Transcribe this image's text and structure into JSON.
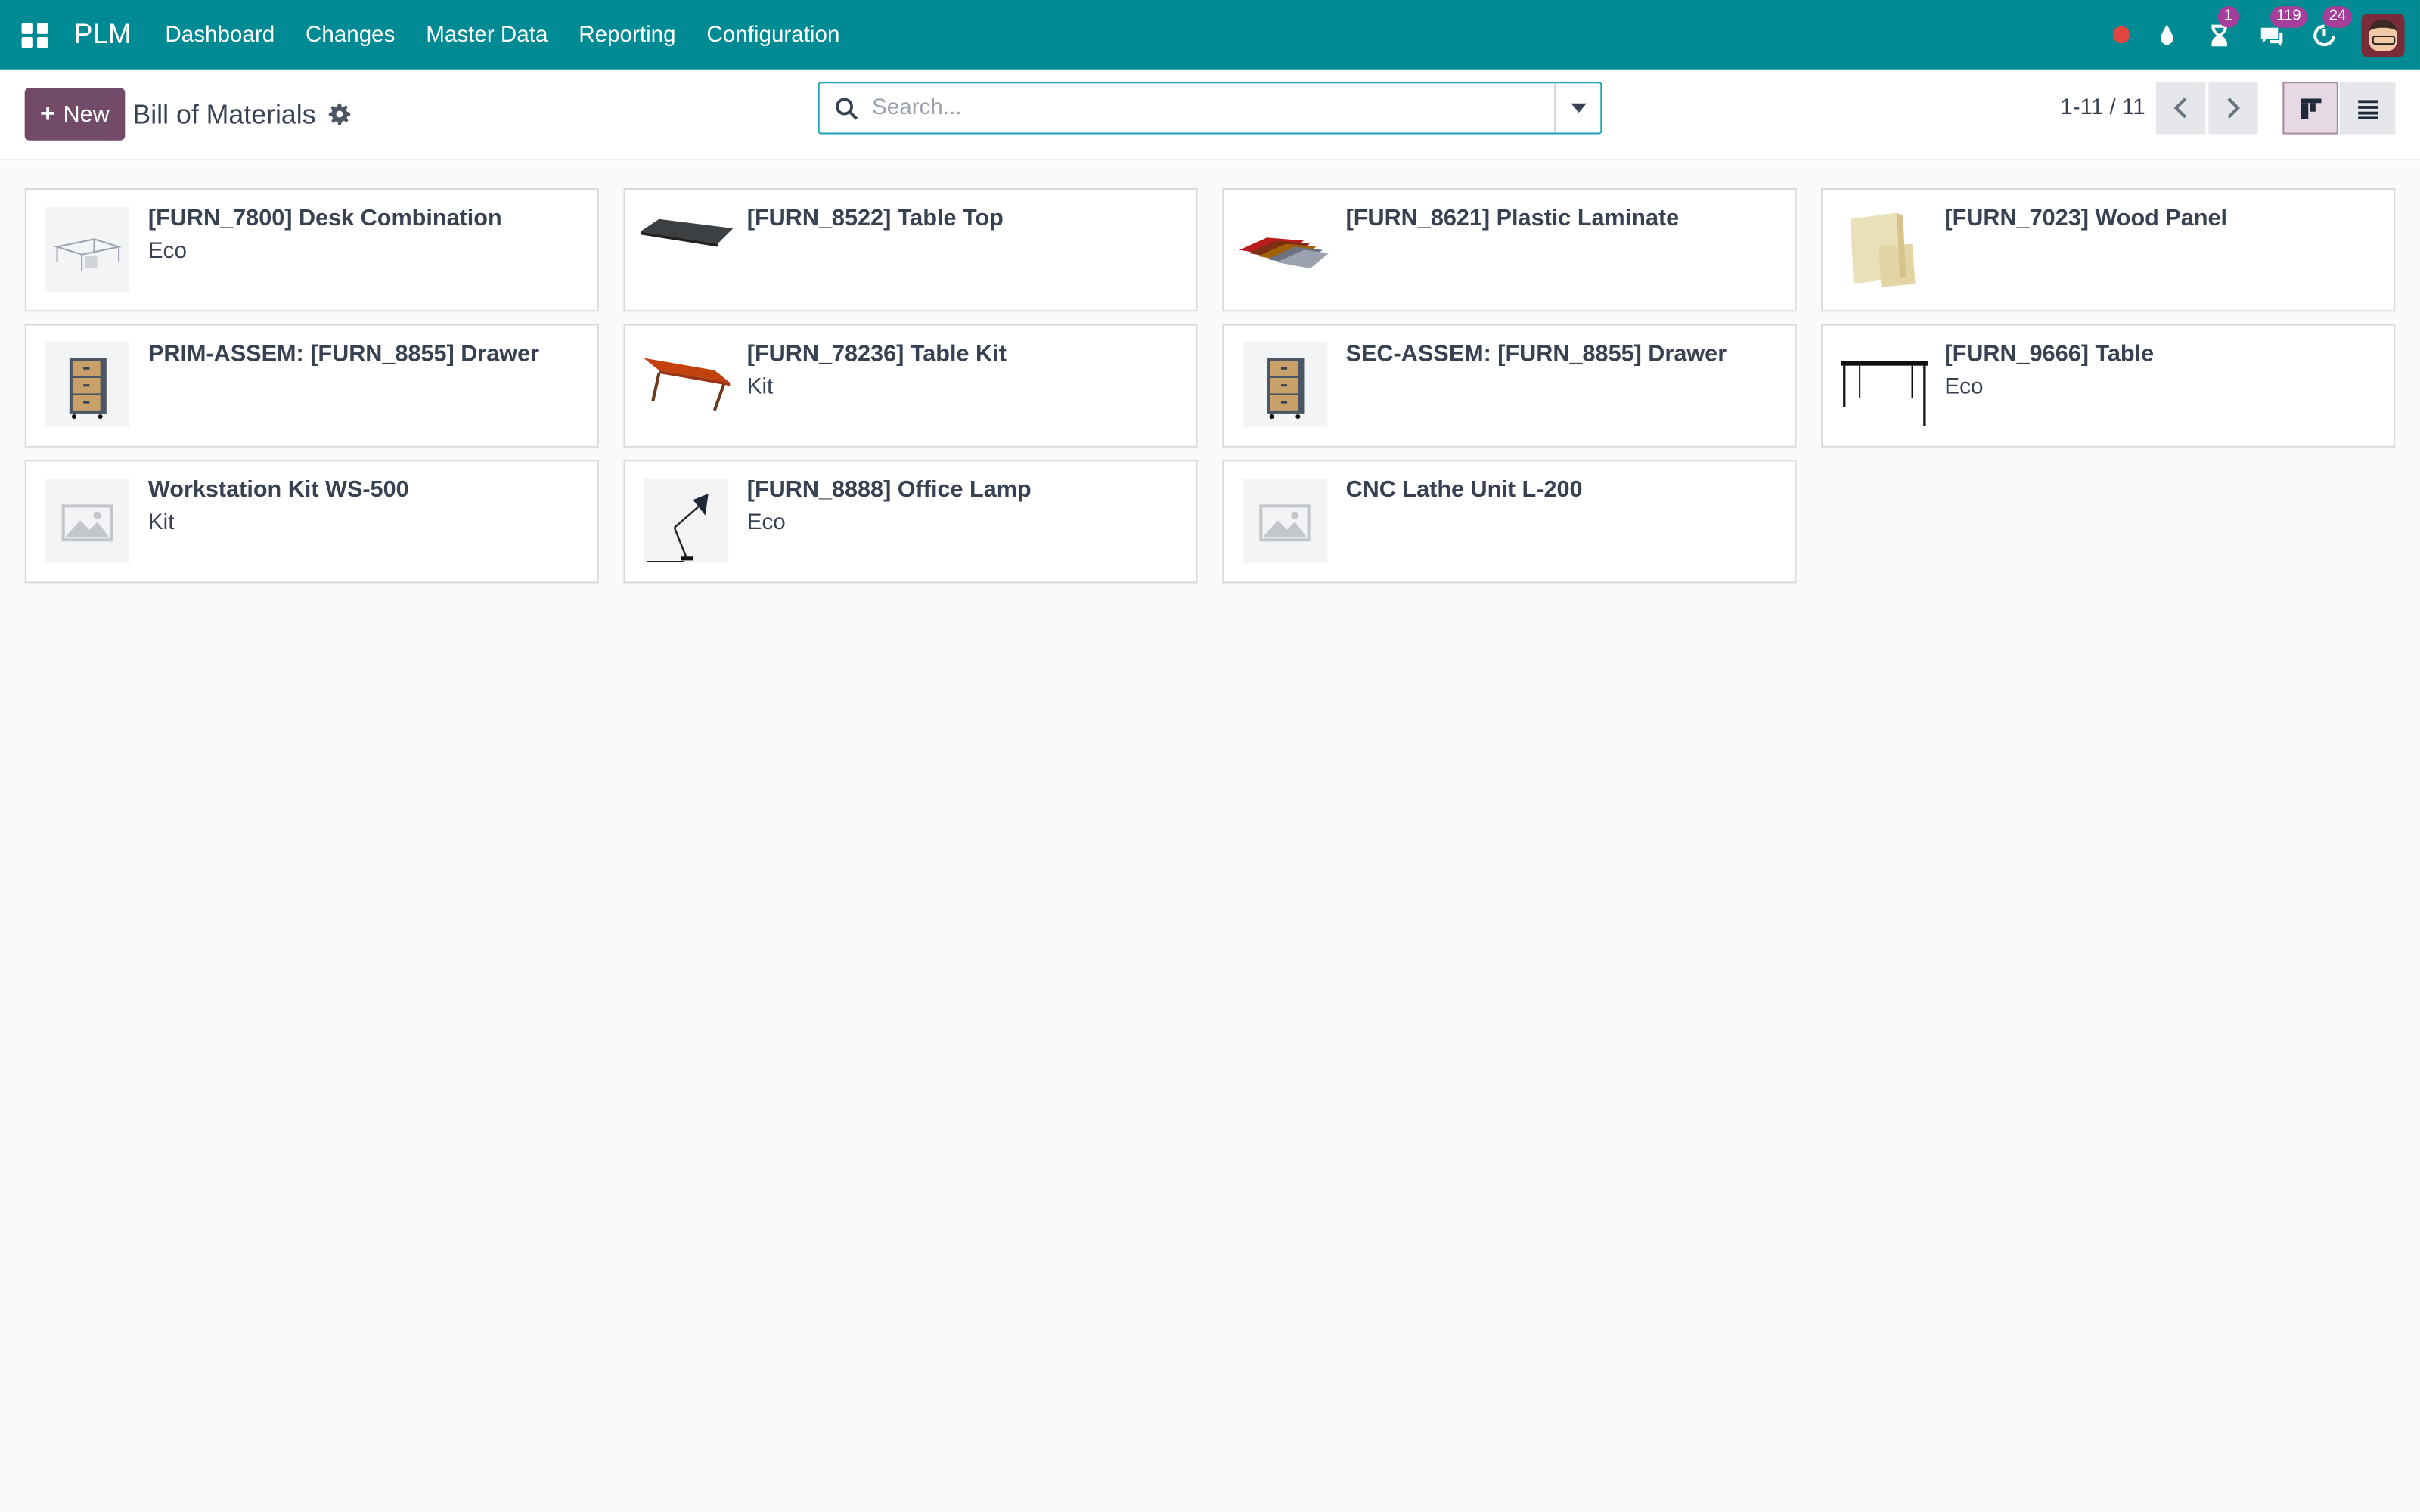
{
  "navbar": {
    "brand": "PLM",
    "menu": [
      "Dashboard",
      "Changes",
      "Master Data",
      "Reporting",
      "Configuration"
    ],
    "badges": {
      "activities": "1",
      "messages": "119",
      "updates": "24"
    }
  },
  "control": {
    "new_label": "New",
    "breadcrumb": "Bill of Materials",
    "search_placeholder": "Search...",
    "pager": "1-11 / 11"
  },
  "cards": [
    {
      "title": "[FURN_7800] Desk Combination",
      "tag": "Eco",
      "image": "desk-combination"
    },
    {
      "title": "[FURN_8522] Table Top",
      "tag": "",
      "image": "table-top"
    },
    {
      "title": "[FURN_8621] Plastic Laminate",
      "tag": "",
      "image": "laminate"
    },
    {
      "title": "[FURN_7023] Wood Panel",
      "tag": "",
      "image": "wood-panel"
    },
    {
      "title": "PRIM-ASSEM: [FURN_8855] Drawer",
      "tag": "",
      "image": "drawer"
    },
    {
      "title": "[FURN_78236] Table Kit",
      "tag": "Kit",
      "image": "table-kit"
    },
    {
      "title": "SEC-ASSEM: [FURN_8855] Drawer",
      "tag": "",
      "image": "drawer"
    },
    {
      "title": "[FURN_9666] Table",
      "tag": "Eco",
      "image": "table"
    },
    {
      "title": "Workstation Kit WS-500",
      "tag": "Kit",
      "image": "placeholder"
    },
    {
      "title": "[FURN_8888] Office Lamp",
      "tag": "Eco",
      "image": "lamp"
    },
    {
      "title": "CNC Lathe Unit L-200",
      "tag": "",
      "image": "placeholder"
    }
  ],
  "colors": {
    "navbar": "#008b94",
    "primary": "#714b67",
    "badge": "#a53f9b"
  }
}
